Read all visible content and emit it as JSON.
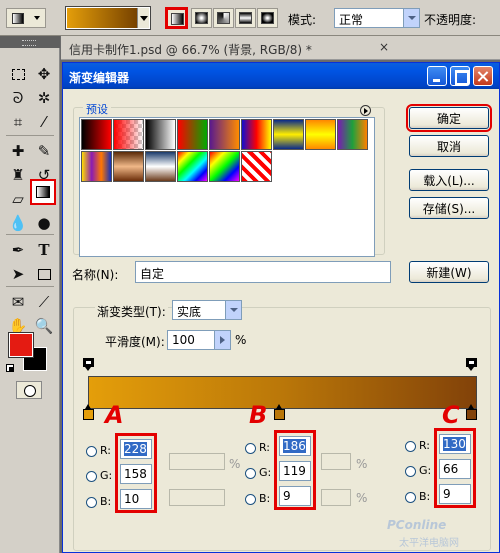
{
  "options_bar": {
    "mode_label": "模式:",
    "mode_value": "正常",
    "opacity_label": "不透明度:"
  },
  "document": {
    "tab_title": "信用卡制作1.psd @ 66.7% (背景, RGB/8) *",
    "close_glyph": "×"
  },
  "dialog": {
    "title": "渐变编辑器",
    "presets_label": "预设",
    "buttons": {
      "ok": "确定",
      "cancel": "取消",
      "load": "载入(L)...",
      "save": "存储(S)...",
      "new": "新建(W)"
    },
    "name_label": "名称(N):",
    "name_value": "自定",
    "gradient_type_label": "渐变类型(T):",
    "gradient_type_value": "实底",
    "smoothness_label": "平滑度(M):",
    "smoothness_value": "100",
    "smoothness_unit": "%"
  },
  "presets": [
    {
      "name": "fg-bg",
      "colors": [
        "#000000",
        "#ff0000"
      ]
    },
    {
      "name": "fg-transparent",
      "colors": [
        "#ff0000",
        "#ffffff"
      ]
    },
    {
      "name": "black-white",
      "colors": [
        "#000000",
        "#ffffff"
      ]
    },
    {
      "name": "red-green",
      "colors": [
        "#ff0000",
        "#00aa00"
      ]
    },
    {
      "name": "violet-orange",
      "colors": [
        "#5a1a8c",
        "#ff8c00"
      ]
    },
    {
      "name": "blue-red-yellow",
      "colors": [
        "#1010d0",
        "#ff0000",
        "#ffff00"
      ]
    },
    {
      "name": "blue-yellow-blue",
      "colors": [
        "#0a2a8a",
        "#ffee00",
        "#0a2a8a"
      ]
    },
    {
      "name": "orange-yellow-orange",
      "colors": [
        "#ff8800",
        "#ffff00",
        "#ff8800"
      ]
    },
    {
      "name": "violet-green-orange",
      "colors": [
        "#7a1ab4",
        "#1ea03c",
        "#ff8000"
      ]
    },
    {
      "name": "yellow-violet-orange-blue",
      "colors": [
        "#ffdd00",
        "#8a1ab4",
        "#ff7700",
        "#1030c0"
      ]
    },
    {
      "name": "copper",
      "colors": [
        "#5a2a08",
        "#f0b888",
        "#6a2c08"
      ]
    },
    {
      "name": "chrome",
      "colors": [
        "#1a3a6a",
        "#ffffff",
        "#6a3a1a"
      ]
    },
    {
      "name": "spectrum",
      "colors": [
        "#ff0000",
        "#ffff00",
        "#00ff00",
        "#00ffff",
        "#0000ff",
        "#ff00ff"
      ]
    },
    {
      "name": "transparent-rainbow",
      "colors": [
        "#ff0000",
        "#ffff00",
        "#00ff00",
        "#0000ff",
        "#ff00ff"
      ]
    },
    {
      "name": "transparent-stripes",
      "colors": [
        "#ff0000",
        "#ffffff",
        "#ff0000"
      ]
    }
  ],
  "gradient": {
    "start_color": "#e49e0a",
    "mid_color": "#ba7709",
    "end_color": "#824209"
  },
  "stops": [
    {
      "label": "A",
      "r": "228",
      "g": "158",
      "b": "10",
      "color": "#e49e0a"
    },
    {
      "label": "B",
      "r": "186",
      "g": "119",
      "b": "9",
      "color": "#ba7709"
    },
    {
      "label": "C",
      "r": "130",
      "g": "66",
      "b": "9",
      "color": "#824209"
    }
  ],
  "channel_labels": {
    "r": "R:",
    "g": "G:",
    "b": "B:",
    "pct": "%"
  },
  "watermark": {
    "line1": "PConline",
    "line2": "太平洋电脑网"
  },
  "colors": {
    "accent_red": "#e30000",
    "foreground": "#e41b12",
    "background": "#000000",
    "xp_blue": "#0054e3"
  }
}
